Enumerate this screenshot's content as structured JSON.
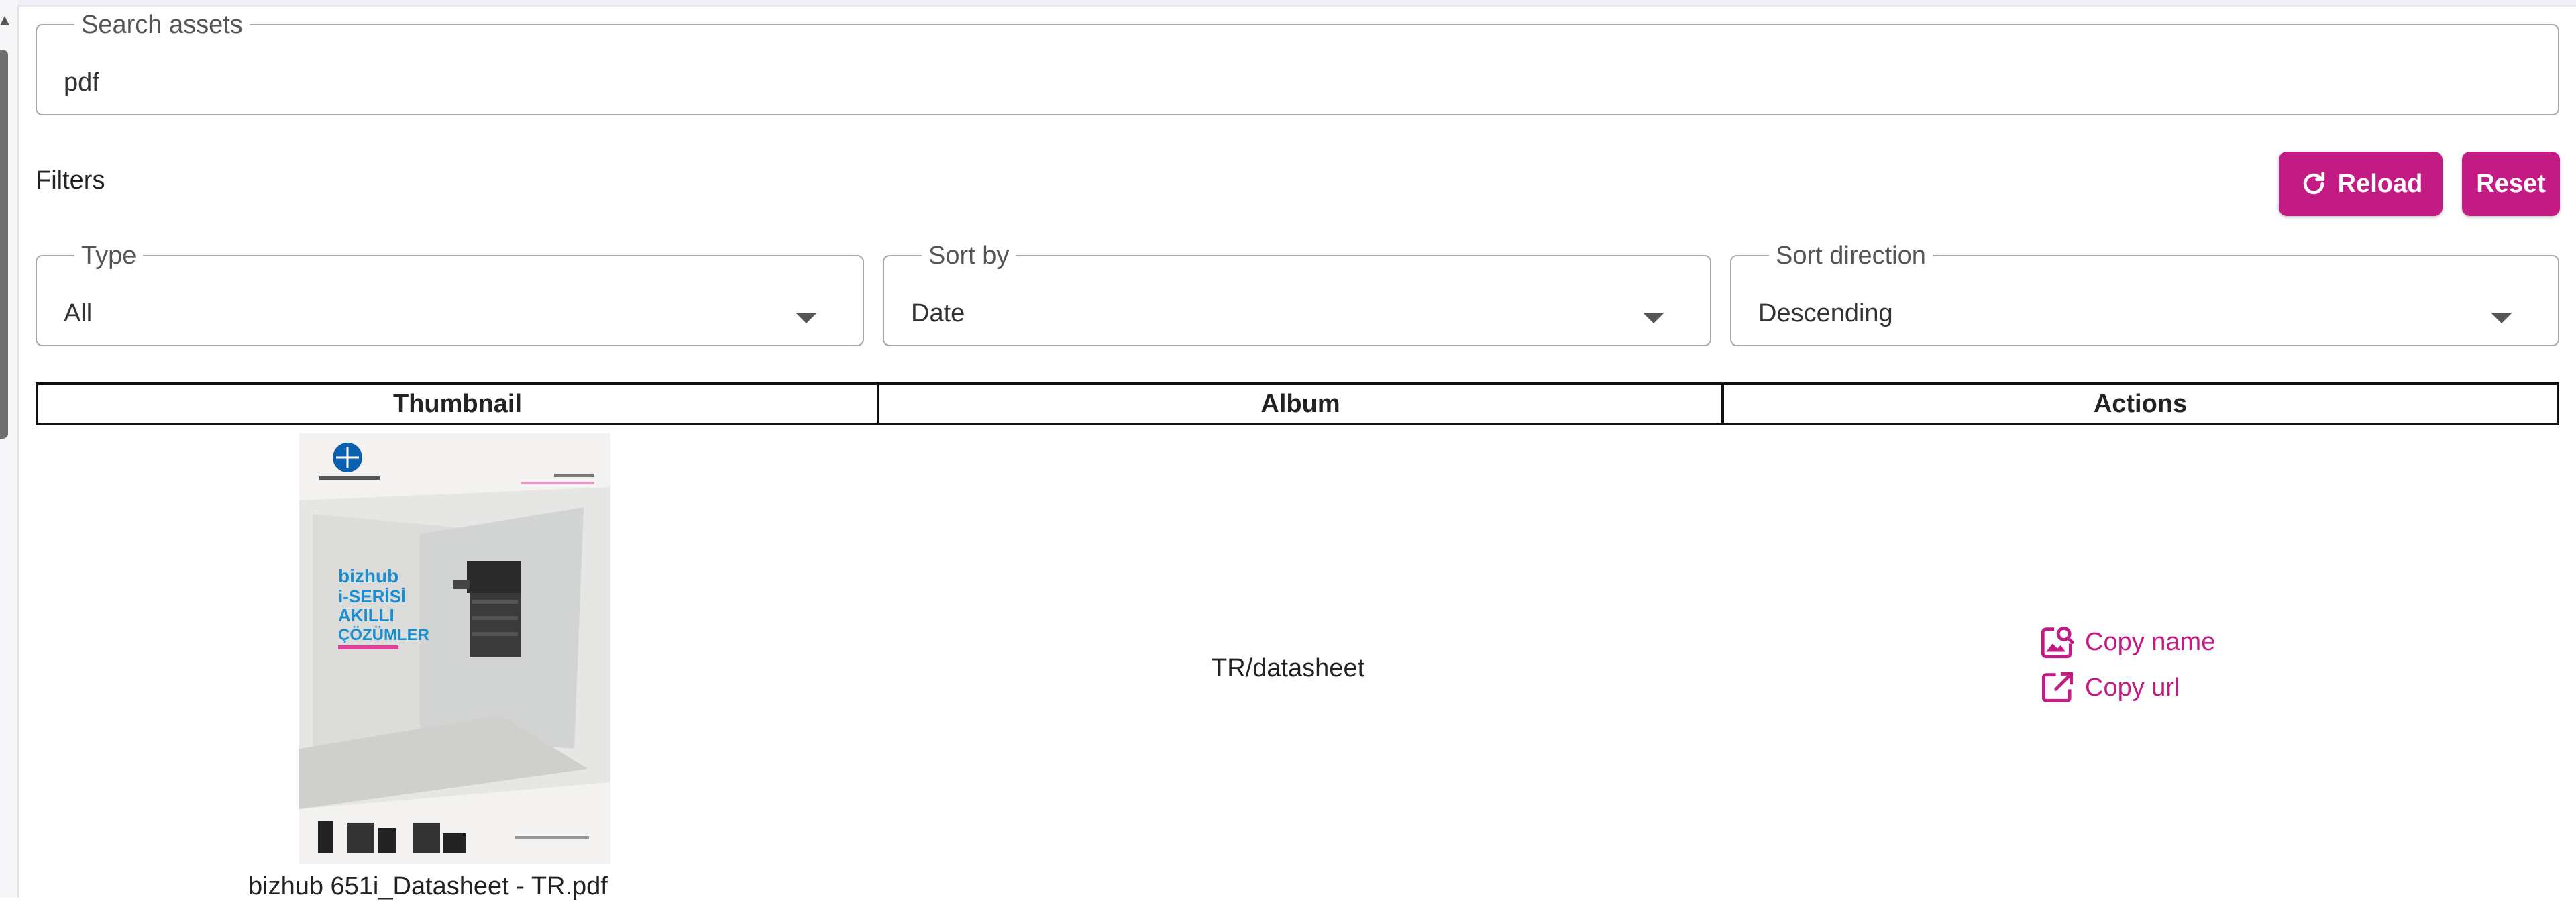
{
  "search": {
    "label": "Search assets",
    "value": "pdf"
  },
  "filters": {
    "title": "Filters",
    "reload_label": "Reload",
    "reset_label": "Reset",
    "type": {
      "label": "Type",
      "value": "All"
    },
    "sort_by": {
      "label": "Sort by",
      "value": "Date"
    },
    "sort_direction": {
      "label": "Sort direction",
      "value": "Descending"
    }
  },
  "table": {
    "headers": [
      "Thumbnail",
      "Album",
      "Actions"
    ],
    "rows": [
      {
        "thumbnail_caption": "bizhub 651i_Datasheet - TR.pdf",
        "album": "TR/datasheet",
        "actions": [
          "Copy name",
          "Copy url"
        ]
      }
    ]
  },
  "thumbnail_doc": {
    "brand": "KONICA MINOLTA",
    "headline": [
      "bizhub",
      "i-SERİSİ",
      "AKILLI",
      "ÇÖZÜMLER"
    ],
    "tagline": "GİVING SHAPE TO IDEAS"
  },
  "colors": {
    "accent": "#c31a84",
    "border": "#a9a9a9"
  },
  "icons": {
    "reload": "reload-icon",
    "copy_name": "image-search-icon",
    "copy_url": "open-external-icon"
  }
}
